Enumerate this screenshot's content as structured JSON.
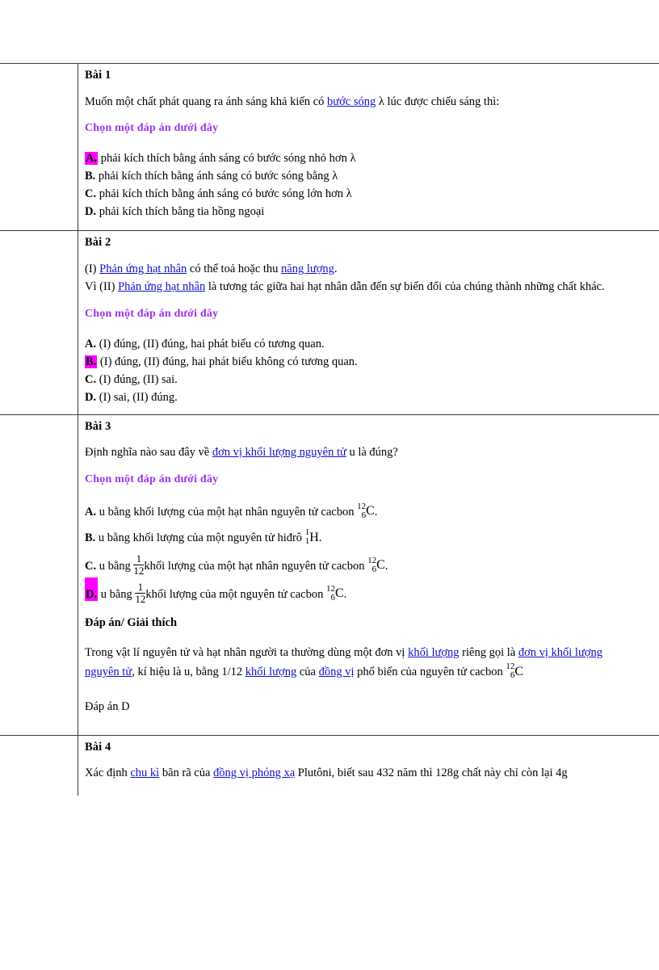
{
  "document": {
    "choose_prompt": "Chọn một đáp án dưới đây"
  },
  "questions": [
    {
      "title": "Bài 1",
      "stem_pre": "Muốn một chất phát quang ra ánh sáng khả kiến có ",
      "stem_link": "bước sóng",
      "stem_post": " λ lúc  được chiếu  sáng thì:",
      "choose_prompt": "Chọn một đáp án dưới đây",
      "options": [
        {
          "label": "A.",
          "text": "phải kích thích  bằng ánh sáng  có bước sóng  nhỏ hơn  λ",
          "highlighted": true
        },
        {
          "label": "B.",
          "text": "phải kích thích  bằng ánh sáng  có bước sóng  bằng  λ",
          "highlighted": false
        },
        {
          "label": "C.",
          "text": "phải kích thích  bằng ánh sáng  có bước sóng  lớn hơn  λ",
          "highlighted": false
        },
        {
          "label": "D.",
          "text": "phải kích thích  bằng tia hồng ngoại",
          "highlighted": false
        }
      ]
    },
    {
      "title": "Bài 2",
      "line1_pre": "(I) ",
      "line1_link1": "Phản ứng hạt nhân",
      "line1_mid": " có thể toả hoặc thu ",
      "line1_link2": "năng lượng",
      "line1_post": ".",
      "line2_pre": "Vì (II) ",
      "line2_link": "Phản ứng hạt nhân",
      "line2_post": " là tương tác giữa  hai hạt nhân  dẫn đến sự biến đổi của chúng  thành  những  chất khác.",
      "choose_prompt": "Chọn một đáp án dưới đây",
      "options": [
        {
          "label": "A.",
          "text": "(I) đúng,  (II) đúng,  hai phát biểu có tương quan.",
          "highlighted": false
        },
        {
          "label": "B.",
          "text": "(I) đúng,  (II) đúng,  hai phát biểu không có tương quan.",
          "highlighted": true
        },
        {
          "label": "C.",
          "text": "(I) đúng,  (II) sai.",
          "highlighted": false
        },
        {
          "label": "D.",
          "text": "(I) sai, (II) đúng.",
          "highlighted": false
        }
      ]
    },
    {
      "title": "Bài 3",
      "stem_pre": "Định nghĩa  nào sau đây về ",
      "stem_link": "đơn vị khối lượng nguyên  tử",
      "stem_post": " u là đúng?",
      "choose_prompt": "Chọn một đáp án dưới đây",
      "options": [
        {
          "label": "A.",
          "text_before": "u bằng khối lượng  của một hạt nhân nguyên  tử cacbon ",
          "fraction": null,
          "isotope": {
            "mass": "12",
            "atomic": "6",
            "element": "C"
          },
          "text_after": ".",
          "highlighted": false
        },
        {
          "label": "B.",
          "text_before": "u bằng khối lượng  của một nguyên  tử hiđrô ",
          "fraction": null,
          "isotope": {
            "mass": "1",
            "atomic": "1",
            "element": "H"
          },
          "text_after": ".",
          "highlighted": false
        },
        {
          "label": "C.",
          "text_before": "u bằng ",
          "fraction": {
            "num": "1",
            "den": "12"
          },
          "text_mid": "khối lượng  của một hạt nhân  nguyên  tử cacbon ",
          "isotope": {
            "mass": "12",
            "atomic": "6",
            "element": "C"
          },
          "text_after": ".",
          "highlighted": false
        },
        {
          "label": "D.",
          "text_before": "u bằng ",
          "fraction": {
            "num": "1",
            "den": "12"
          },
          "text_mid": "khối lượng  của một nguyên  tử cacbon ",
          "isotope": {
            "mass": "12",
            "atomic": "6",
            "element": "C"
          },
          "text_after": ".",
          "highlighted": true
        }
      ],
      "answer_heading": "Đáp án/ Giải thích",
      "explanation": {
        "seg1": "Trong vật lí nguyên  tử và hạt nhân  người ta thường  dùng  một đơn vị ",
        "link1": "khối lượng",
        "seg2": " riêng  gọi là ",
        "link2": "đơn vị  khối lượng",
        "link3": "nguyên  tử",
        "seg3": ", kí hiệu là u, bằng 1/12 ",
        "link4": "khối lượng",
        "seg4": " của ",
        "link5": "đồng vị",
        "seg5": " phổ biến  của nguyên  tử cacbon ",
        "isotope": {
          "mass": "12",
          "atomic": "6",
          "element": "C"
        }
      },
      "final_answer": "Đáp án D"
    },
    {
      "title": "Bài 4",
      "stem_pre": "Xác định ",
      "stem_link1": "chu kì",
      "stem_mid": " bãn rã của ",
      "stem_link2": "đồng vị phóng xạ",
      "stem_post": " Plutôni,  biết sau 432 năm thì  128g chất này chỉ  còn lại 4g"
    }
  ]
}
